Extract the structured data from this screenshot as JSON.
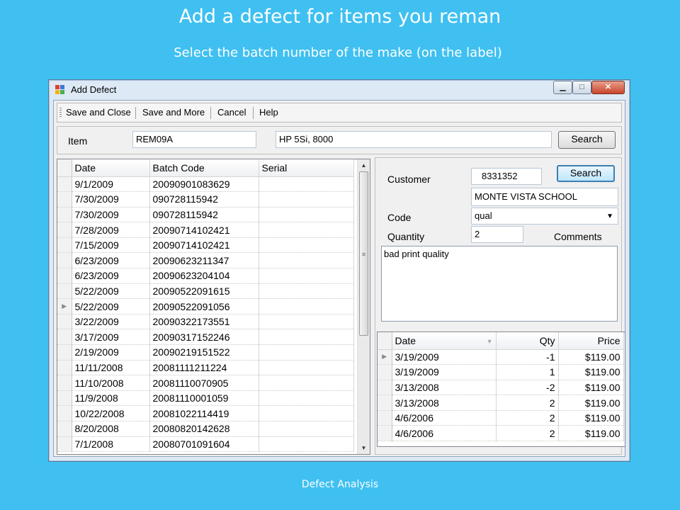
{
  "slide": {
    "title": "Add a defect for items you reman",
    "subtitle": "Select the batch number of the make (on the label)",
    "footer": "Defect Analysis"
  },
  "window": {
    "title": "Add Defect",
    "icon": "app-window-icon",
    "minimize_glyph": "▁",
    "maximize_glyph": "□",
    "close_glyph": "✕"
  },
  "toolbar": {
    "save_close": "Save and Close",
    "save_more": "Save and More",
    "cancel": "Cancel",
    "help": "Help"
  },
  "item": {
    "label": "Item",
    "code": "REM09A",
    "description": "HP 5Si, 8000",
    "search_label": "Search"
  },
  "batch_grid": {
    "columns": [
      "Date",
      "Batch Code",
      "Serial"
    ],
    "current_row_marker": "▶",
    "rows": [
      {
        "date": "9/1/2009",
        "batch": "20090901083629",
        "serial": ""
      },
      {
        "date": "7/30/2009",
        "batch": "090728115942",
        "serial": ""
      },
      {
        "date": "7/30/2009",
        "batch": "090728115942",
        "serial": ""
      },
      {
        "date": "7/28/2009",
        "batch": "20090714102421",
        "serial": ""
      },
      {
        "date": "7/15/2009",
        "batch": "20090714102421",
        "serial": ""
      },
      {
        "date": "6/23/2009",
        "batch": "20090623211347",
        "serial": ""
      },
      {
        "date": "6/23/2009",
        "batch": "20090623204104",
        "serial": ""
      },
      {
        "date": "5/22/2009",
        "batch": "20090522091615",
        "serial": ""
      },
      {
        "date": "5/22/2009",
        "batch": "20090522091056",
        "serial": "",
        "current": true
      },
      {
        "date": "3/22/2009",
        "batch": "20090322173551",
        "serial": ""
      },
      {
        "date": "3/17/2009",
        "batch": "20090317152246",
        "serial": ""
      },
      {
        "date": "2/19/2009",
        "batch": "20090219151522",
        "serial": ""
      },
      {
        "date": "11/11/2008",
        "batch": "20081111211224",
        "serial": ""
      },
      {
        "date": "11/10/2008",
        "batch": "20081110070905",
        "serial": ""
      },
      {
        "date": "11/9/2008",
        "batch": "20081110001059",
        "serial": ""
      },
      {
        "date": "10/22/2008",
        "batch": "20081022114419",
        "serial": ""
      },
      {
        "date": "8/20/2008",
        "batch": "20080820142628",
        "serial": ""
      },
      {
        "date": "7/1/2008",
        "batch": "20080701091604",
        "serial": ""
      }
    ]
  },
  "customer": {
    "label": "Customer",
    "number": "8331352",
    "name": "MONTE VISTA SCHOOL",
    "search_label": "Search"
  },
  "code": {
    "label": "Code",
    "value": "qual"
  },
  "quantity": {
    "label": "Quantity",
    "value": "2"
  },
  "comments": {
    "label": "Comments",
    "value": "bad print quality"
  },
  "history_grid": {
    "columns": [
      "Date",
      "Qty",
      "Price"
    ],
    "current_row_marker": "▶",
    "rows": [
      {
        "date": "3/19/2009",
        "qty": "-1",
        "price": "$119.00",
        "current": true
      },
      {
        "date": "3/19/2009",
        "qty": "1",
        "price": "$119.00"
      },
      {
        "date": "3/13/2008",
        "qty": "-2",
        "price": "$119.00"
      },
      {
        "date": "3/13/2008",
        "qty": "2",
        "price": "$119.00"
      },
      {
        "date": "4/6/2006",
        "qty": "2",
        "price": "$119.00"
      },
      {
        "date": "4/6/2006",
        "qty": "2",
        "price": "$119.00"
      }
    ]
  }
}
